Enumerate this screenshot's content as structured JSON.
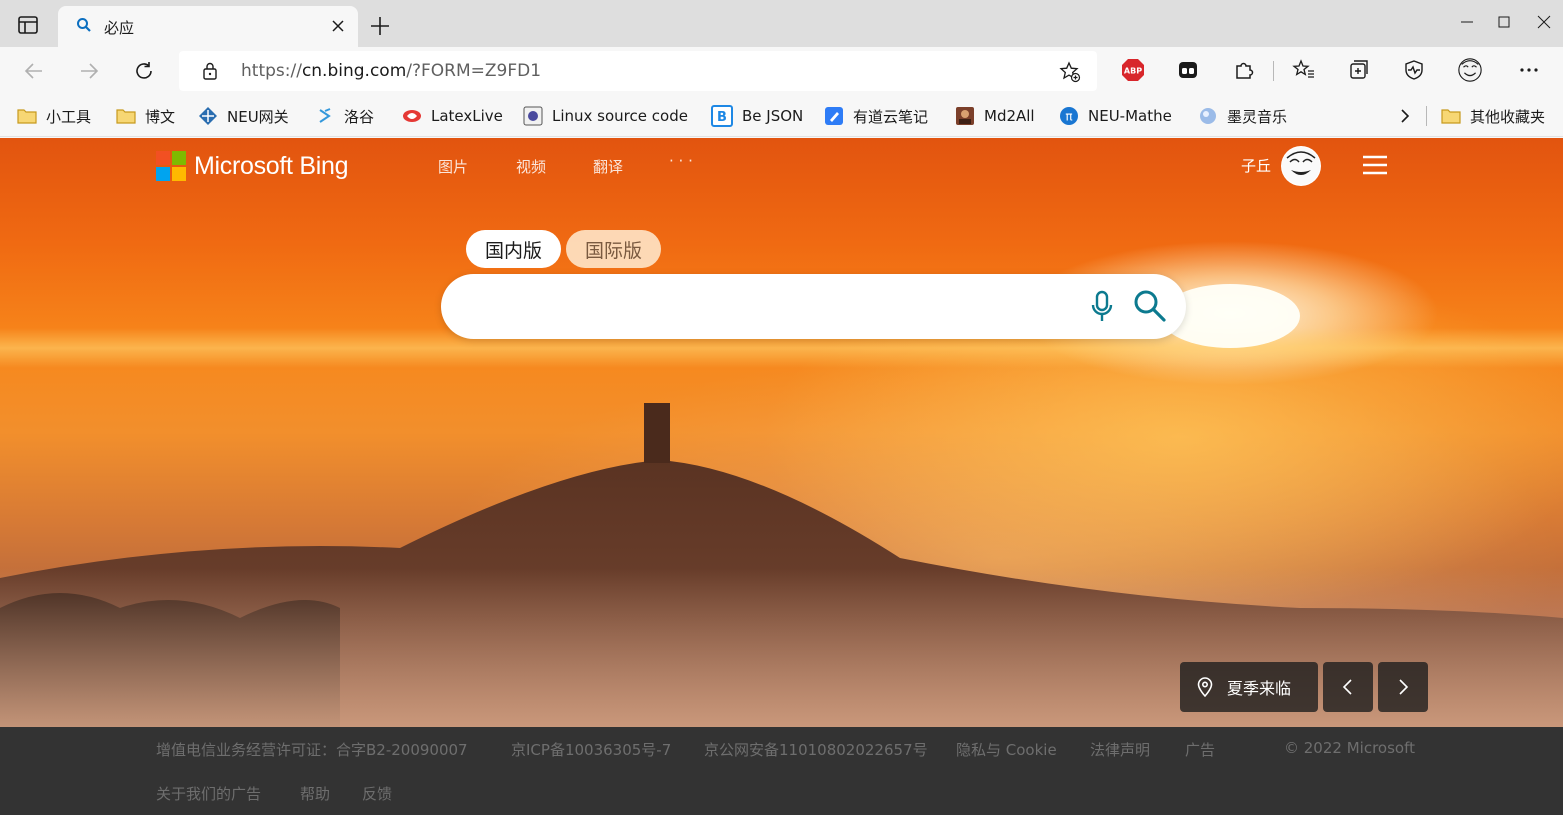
{
  "browser": {
    "tab": {
      "title": "必应"
    },
    "url": {
      "scheme": "https://",
      "host": "cn.bing.com",
      "path": "/?FORM=Z9FD1"
    },
    "extensions": {
      "abp_label": "ABP"
    },
    "bookmarks": [
      {
        "label": "小工具",
        "icon": "folder-icon"
      },
      {
        "label": "博文",
        "icon": "folder-icon"
      },
      {
        "label": "NEU网关",
        "icon": "network-icon"
      },
      {
        "label": "洛谷",
        "icon": "luogu-icon"
      },
      {
        "label": "LatexLive",
        "icon": "latexlive-icon"
      },
      {
        "label": "Linux source code",
        "icon": "linux-icon"
      },
      {
        "label": "Be JSON",
        "icon": "bejson-icon"
      },
      {
        "label": "有道云笔记",
        "icon": "youdao-icon"
      },
      {
        "label": "Md2All",
        "icon": "md2all-icon"
      },
      {
        "label": "NEU-Mathe",
        "icon": "pi-icon"
      },
      {
        "label": "墨灵音乐",
        "icon": "music-icon"
      }
    ],
    "other_bookmarks": "其他收藏夹"
  },
  "bing": {
    "logo_text": "Microsoft Bing",
    "nav": [
      "图片",
      "视频",
      "翻译",
      "· · ·"
    ],
    "user_name": "子丘",
    "scope_tabs": [
      "国内版",
      "国际版"
    ],
    "search": {
      "placeholder": ""
    },
    "image_location": "夏季来临"
  },
  "footer": {
    "row1": [
      "增值电信业务经营许可证：合字B2-20090007",
      "京ICP备10036305号-7",
      "京公网安备11010802022657号",
      "隐私与 Cookie",
      "法律声明",
      "广告",
      "© 2022 Microsoft"
    ],
    "row2": [
      "关于我们的广告",
      "帮助",
      "反馈"
    ]
  },
  "colors": {
    "sky_top": "#e2540f",
    "sky_mid": "#f7871b",
    "footer_bg": "#333333",
    "search_icon": "#0c7a8f"
  }
}
